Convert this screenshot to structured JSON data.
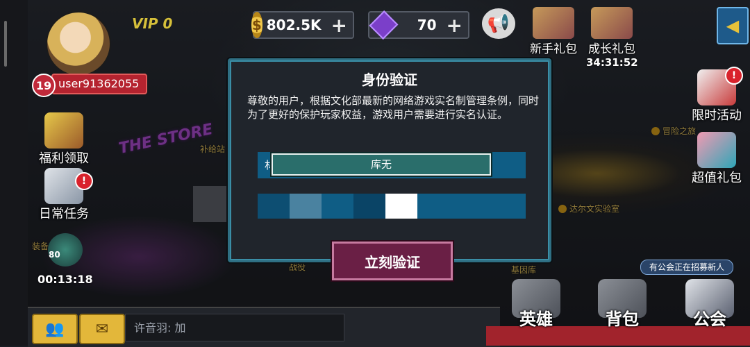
{
  "player": {
    "level": "19",
    "username": "user91362055",
    "vip_label": "VIP",
    "vip_level": "0"
  },
  "currency": {
    "gold": "802.5K",
    "gems": "70"
  },
  "top_right": {
    "newbie_pack": "新手礼包",
    "growth_pack": "成长礼包",
    "growth_timer": "34:31:52"
  },
  "left_menu": {
    "welfare": "福利领取",
    "daily_tasks": "日常任务",
    "event_count": "80",
    "event_timer": "00:13:18"
  },
  "right_menu": {
    "limited_event": "限时活动",
    "value_pack": "超值礼包"
  },
  "map": {
    "store_sign": "THE STORE",
    "supply_station": "补给站",
    "campaign": "战役",
    "gene_lab": "基因库",
    "adventure": "冒险之旅",
    "darwin_lab": "达尔文实验室",
    "equip": "装备",
    "guild_recruit": "有公会正在招募新人"
  },
  "dialog": {
    "title": "身份验证",
    "body": "尊敬的用户，根据文化部最新的网络游戏实名制管理条例，同时为了更好的保护玩家权益，游戏用户需要进行实名认证。",
    "name_prefix": "林",
    "name_value": "库无",
    "verify_button": "立刻验证"
  },
  "chat": {
    "last_message": "许音羽: 加"
  },
  "bottom_tabs": {
    "heroes": "英雄",
    "bag": "背包",
    "guild": "公会"
  },
  "colors": {
    "dialog_border": "#2f6f83",
    "input_fill": "#0f5d85",
    "verify_button": "#6a1f45"
  }
}
